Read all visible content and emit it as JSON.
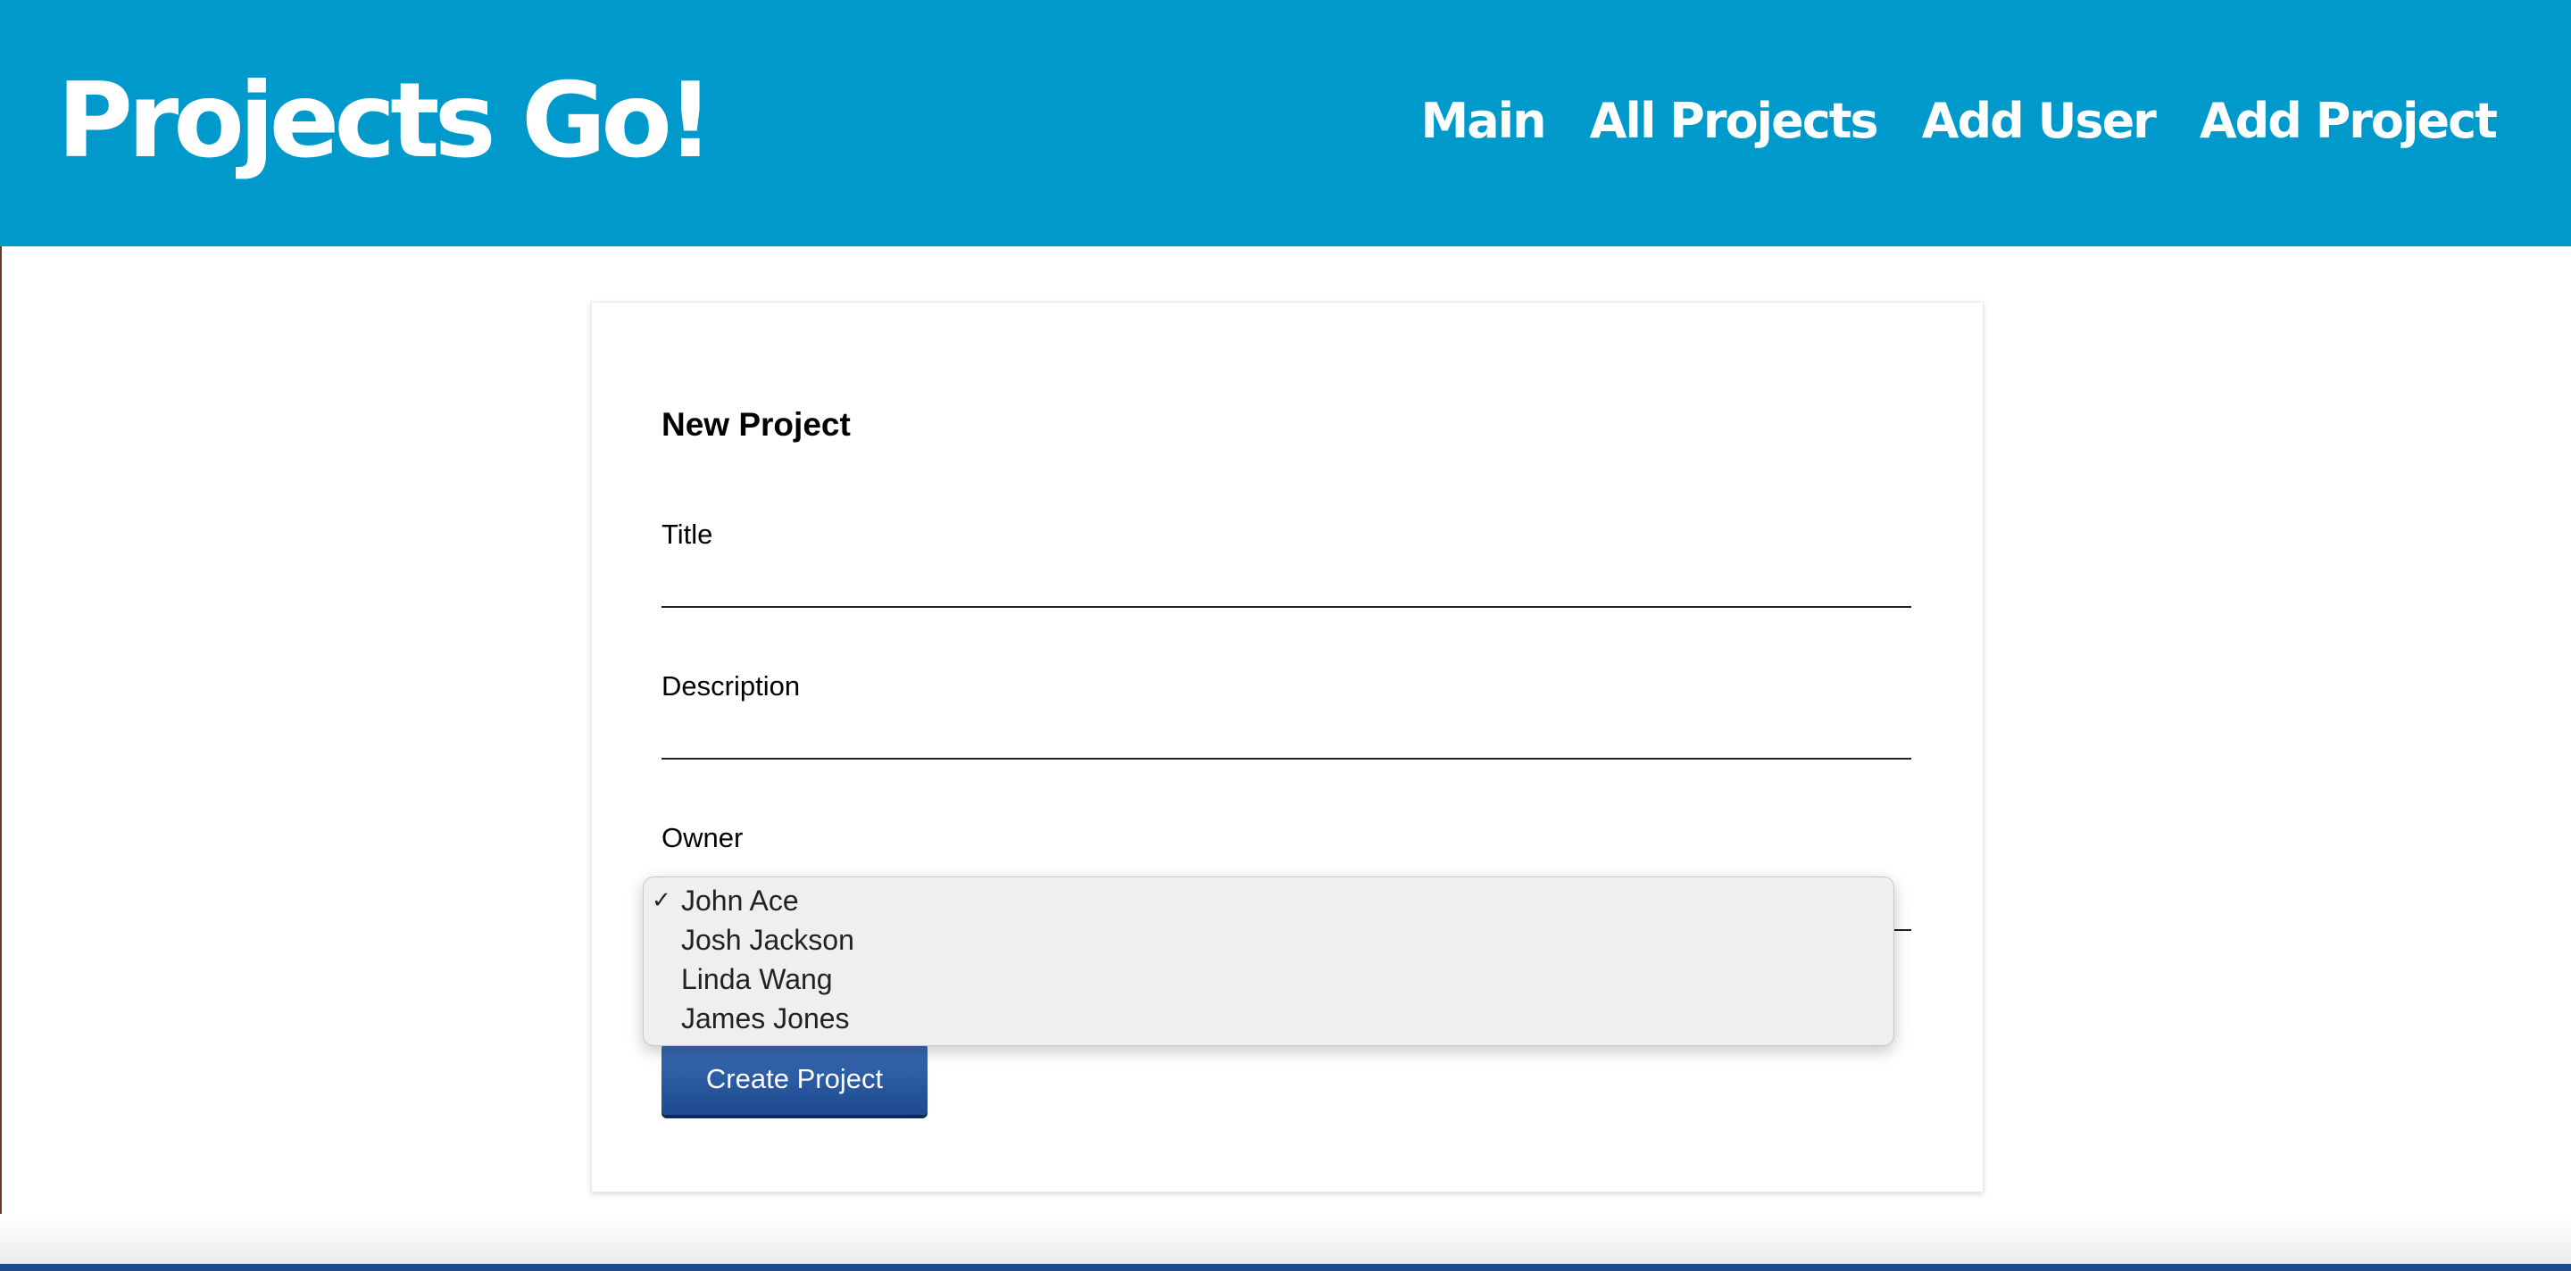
{
  "header": {
    "brand": "Projects Go!",
    "nav": [
      {
        "label": "Main"
      },
      {
        "label": "All Projects"
      },
      {
        "label": "Add User"
      },
      {
        "label": "Add Project"
      }
    ]
  },
  "form": {
    "heading": "New Project",
    "title_label": "Title",
    "title_value": "",
    "description_label": "Description",
    "description_value": "",
    "owner_label": "Owner",
    "owner_selected": "John Ace",
    "owner_options": [
      "John Ace",
      "Josh Jackson",
      "Linda Wang",
      "James Jones"
    ],
    "submit_label": "Create Project"
  },
  "colors": {
    "header_bg": "#0099cc",
    "button_bg": "#2a5ca6"
  },
  "icons": {
    "selected_marker": "checkmark-icon"
  }
}
